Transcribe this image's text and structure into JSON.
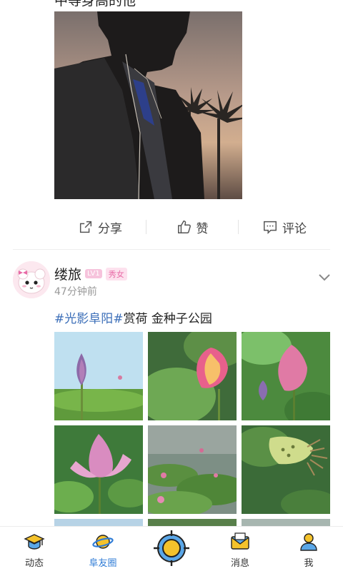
{
  "feed": {
    "previous_post": {
      "cut_text": "中等身高的他"
    },
    "actions": {
      "share_label": "分享",
      "like_label": "赞",
      "comment_label": "评论"
    },
    "post": {
      "author": "缕旅",
      "level_badge": "LV1",
      "tag_badge": "秀女",
      "time": "47分钟前",
      "hashtag_1": "#光影阜阳",
      "hashtag_2": "#",
      "text": "赏荷 金种子公园"
    }
  },
  "bottom_nav": {
    "items": [
      {
        "label": "动态",
        "icon": "graduation-cap-icon"
      },
      {
        "label": "阜友圈",
        "icon": "planet-icon"
      },
      {
        "label": "",
        "icon": "target-icon"
      },
      {
        "label": "消息",
        "icon": "envelope-icon"
      },
      {
        "label": "我",
        "icon": "user-icon"
      }
    ],
    "active_color": "#2f7cd6"
  },
  "colors": {
    "hashtag": "#3b6eb8",
    "badge_pink": "#e86aa6"
  }
}
